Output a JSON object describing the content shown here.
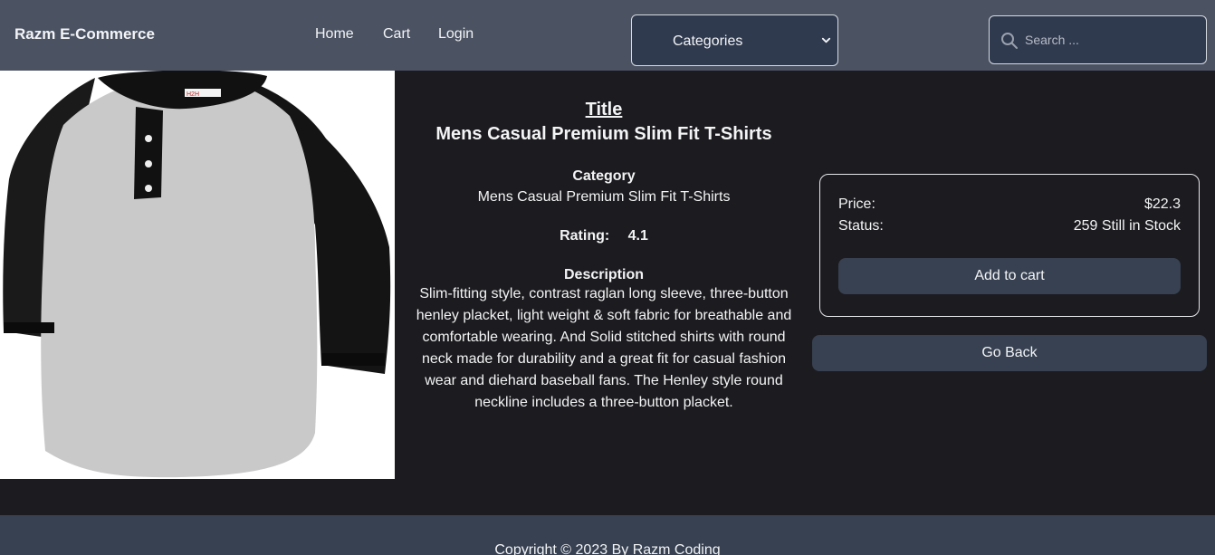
{
  "navbar": {
    "brand": "Razm E-Commerce",
    "links": [
      "Home",
      "Cart",
      "Login"
    ],
    "categories_label": "Categories",
    "search_placeholder": "Search ..."
  },
  "product": {
    "title_heading": "Title",
    "title": "Mens Casual Premium Slim Fit T-Shirts",
    "category_heading": "Category",
    "category": "Mens Casual Premium Slim Fit T-Shirts",
    "rating_label": "Rating:",
    "rating": "4.1",
    "description_heading": "Description",
    "description": "Slim-fitting style, contrast raglan long sleeve, three-button henley placket, light weight & soft fabric for breathable and comfortable wearing. And Solid stitched shirts with round neck made for durability and a great fit for casual fashion wear and diehard baseball fans. The Henley style round neckline includes a three-button placket.",
    "image_name": "henley-raglan-t-shirt-image",
    "image_tag": "H2H"
  },
  "purchase": {
    "price_label": "Price:",
    "price": "$22.3",
    "status_label": "Status:",
    "status": "259 Still in Stock",
    "add_to_cart": "Add to cart",
    "go_back": "Go Back"
  },
  "footer": {
    "text": "Copyright © 2023 By Razm Coding"
  },
  "colors": {
    "navbar_bg": "#4b5363",
    "page_bg": "#1c1b1f",
    "button_bg": "#374151",
    "input_bg": "#2f3a4f",
    "text": "#f3f4f6"
  }
}
